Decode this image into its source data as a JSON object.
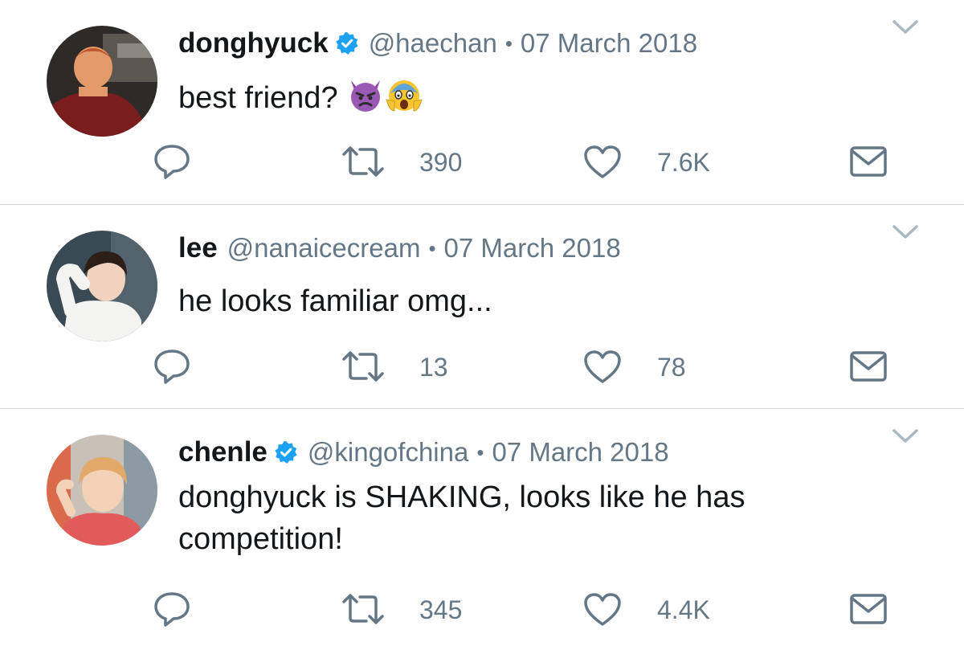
{
  "tweets": [
    {
      "name": "donghyuck",
      "verified": true,
      "handle": "@haechan",
      "separator": "•",
      "date": "07 March 2018",
      "text": "best friend?",
      "emojis": [
        "smiling-imp-emoji",
        "screaming-face-emoji"
      ],
      "retweets": "390",
      "likes": "7.6K"
    },
    {
      "name": "lee",
      "verified": false,
      "handle": "@nanaicecream",
      "separator": "•",
      "date": "07 March 2018",
      "text": "he looks familiar omg...",
      "emojis": [],
      "retweets": "13",
      "likes": "78"
    },
    {
      "name": "chenle",
      "verified": true,
      "handle": "@kingofchina",
      "separator": "•",
      "date": "07 March 2018",
      "text": "donghyuck is SHAKING, looks like he has competition!",
      "emojis": [],
      "retweets": "345",
      "likes": "4.4K"
    }
  ],
  "icons": {
    "reply": "reply-icon",
    "retweet": "retweet-icon",
    "like": "heart-icon",
    "dm": "envelope-icon",
    "more": "chevron-down-icon",
    "verified": "verified-badge-icon"
  },
  "colors": {
    "text": "#14171a",
    "secondary": "#657786",
    "verified": "#1da1f2",
    "divider": "#d4d7da"
  }
}
